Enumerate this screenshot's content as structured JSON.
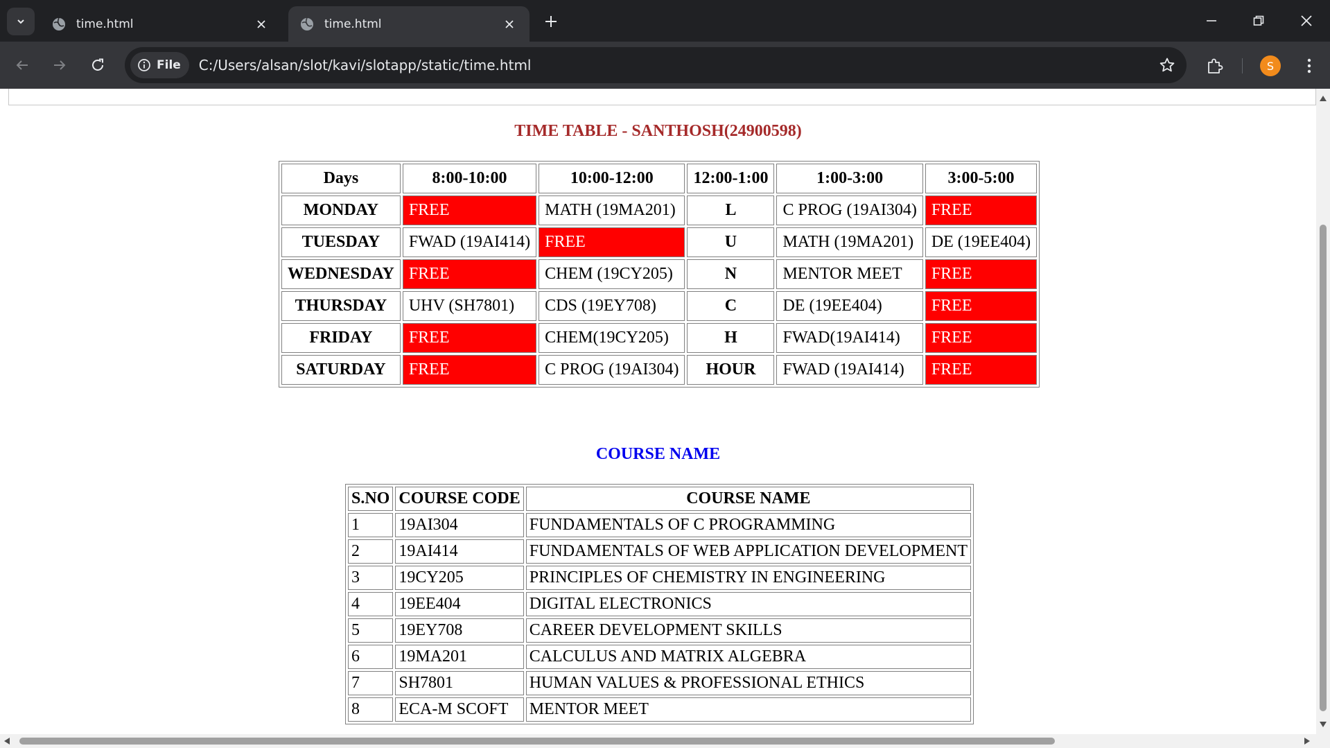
{
  "browser": {
    "tabs": [
      {
        "title": "time.html",
        "active": false
      },
      {
        "title": "time.html",
        "active": true
      }
    ],
    "address": {
      "scheme_label": "File",
      "url": "C:/Users/alsan/slot/kavi/slotapp/static/time.html"
    },
    "profile_initial": "S",
    "accent_color": "#f28b1c"
  },
  "page": {
    "timetable_title": "TIME TABLE - SANTHOSH(24900598)",
    "timetable_title_color": "#a52a2a",
    "free_color": "#ff0000",
    "timetable": {
      "headers": [
        "Days",
        "8:00-10:00",
        "10:00-12:00",
        "12:00-1:00",
        "1:00-3:00",
        "3:00-5:00"
      ],
      "rows": [
        {
          "day": "MONDAY",
          "s1": "FREE",
          "s2": "MATH (19MA201)",
          "lunch": "L",
          "s3": "C PROG (19AI304)",
          "s4": "FREE"
        },
        {
          "day": "TUESDAY",
          "s1": "FWAD (19AI414)",
          "s2": "FREE",
          "lunch": "U",
          "s3": "MATH (19MA201)",
          "s4": "DE (19EE404)"
        },
        {
          "day": "WEDNESDAY",
          "s1": "FREE",
          "s2": "CHEM (19CY205)",
          "lunch": "N",
          "s3": "MENTOR MEET",
          "s4": "FREE"
        },
        {
          "day": "THURSDAY",
          "s1": "UHV (SH7801)",
          "s2": "CDS (19EY708)",
          "lunch": "C",
          "s3": "DE (19EE404)",
          "s4": "FREE"
        },
        {
          "day": "FRIDAY",
          "s1": "FREE",
          "s2": "CHEM(19CY205)",
          "lunch": "H",
          "s3": "FWAD(19AI414)",
          "s4": "FREE"
        },
        {
          "day": "SATURDAY",
          "s1": "FREE",
          "s2": "C PROG (19AI304)",
          "lunch": "HOUR",
          "s3": "FWAD (19AI414)",
          "s4": "FREE"
        }
      ]
    },
    "course_title": "COURSE NAME",
    "course_title_color": "#0000ee",
    "courses": {
      "headers": [
        "S.NO",
        "COURSE CODE",
        "COURSE NAME"
      ],
      "rows": [
        {
          "sno": "1",
          "code": "19AI304",
          "name": "FUNDAMENTALS OF C PROGRAMMING"
        },
        {
          "sno": "2",
          "code": "19AI414",
          "name": "FUNDAMENTALS OF WEB APPLICATION DEVELOPMENT"
        },
        {
          "sno": "3",
          "code": "19CY205",
          "name": "PRINCIPLES OF CHEMISTRY IN ENGINEERING"
        },
        {
          "sno": "4",
          "code": "19EE404",
          "name": "DIGITAL ELECTRONICS"
        },
        {
          "sno": "5",
          "code": "19EY708",
          "name": "CAREER DEVELOPMENT SKILLS"
        },
        {
          "sno": "6",
          "code": "19MA201",
          "name": "CALCULUS AND MATRIX ALGEBRA"
        },
        {
          "sno": "7",
          "code": "SH7801",
          "name": "HUMAN VALUES & PROFESSIONAL ETHICS"
        },
        {
          "sno": "8",
          "code": "ECA-M SCOFT",
          "name": "MENTOR MEET"
        }
      ]
    }
  }
}
